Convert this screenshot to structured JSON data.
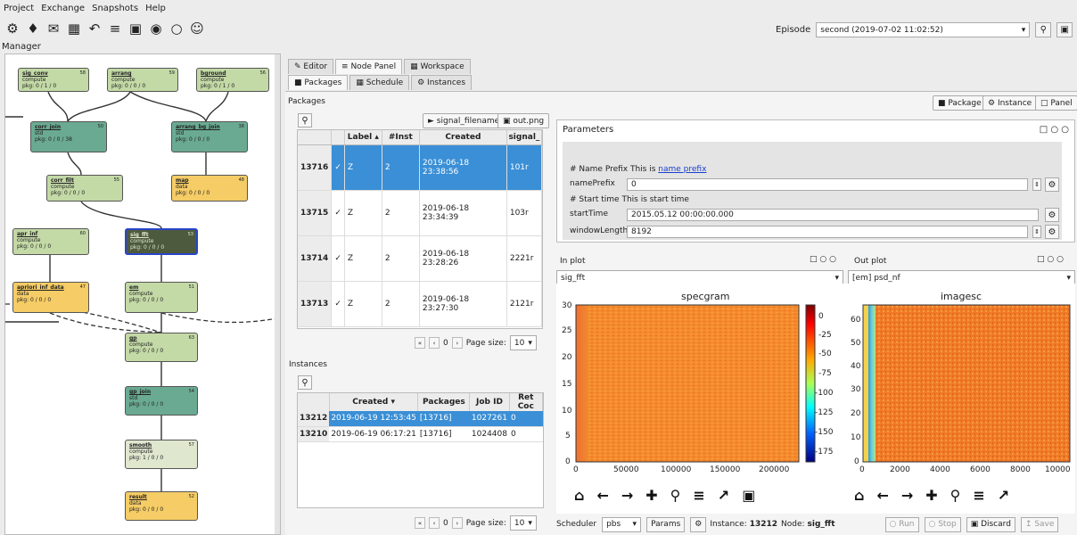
{
  "menu": [
    "Project",
    "Exchange",
    "Snapshots",
    "Help"
  ],
  "toolbar_icons": [
    "network-icon",
    "gem-icon",
    "chat-icon",
    "calendar-icon",
    "undo-icon",
    "sliders-icon",
    "camera-icon",
    "toggle-icon",
    "circle-icon",
    "smiley-icon"
  ],
  "manager_label": "Manager",
  "episode": {
    "label": "Episode",
    "value": "second (2019-07-02 11:02:52)"
  },
  "graph": {
    "nodes": [
      {
        "id": "sig_conv",
        "title": "sig_conv",
        "sub": "compute",
        "pkg": "pkg: 0 / 1 / 0",
        "num": "58",
        "cls": "g"
      },
      {
        "id": "arrang",
        "title": "arrang",
        "sub": "compute",
        "pkg": "pkg: 0 / 0 / 0",
        "num": "59",
        "cls": "g"
      },
      {
        "id": "bground",
        "title": "bground",
        "sub": "compute",
        "pkg": "pkg: 0 / 1 / 0",
        "num": "56",
        "cls": "g"
      },
      {
        "id": "corr_join",
        "title": "corr_join",
        "sub": "std",
        "pkg": "pkg: 0 / 0 / 38",
        "num": "50",
        "cls": "t"
      },
      {
        "id": "arrang_bg_join",
        "title": "arrang_bg_join",
        "sub": "std",
        "pkg": "pkg: 0 / 0 / 0",
        "num": "38",
        "cls": "t"
      },
      {
        "id": "corr_filt",
        "title": "corr_filt",
        "sub": "compute",
        "pkg": "pkg: 0 / 0 / 0",
        "num": "55",
        "cls": "g"
      },
      {
        "id": "map",
        "title": "map",
        "sub": "data",
        "pkg": "pkg: 0 / 0 / 0",
        "num": "48",
        "cls": "y"
      },
      {
        "id": "apr_inf",
        "title": "apr_inf",
        "sub": "compute",
        "pkg": "pkg: 0 / 0 / 0",
        "num": "60",
        "cls": "g"
      },
      {
        "id": "sig_fft",
        "title": "sig_fft",
        "sub": "compute",
        "pkg": "pkg: 0 / 0 / 0",
        "num": "53",
        "cls": "dk"
      },
      {
        "id": "apriori_inf_data",
        "title": "apriori_inf_data",
        "sub": "data",
        "pkg": "pkg: 0 / 0 / 0",
        "num": "47",
        "cls": "y"
      },
      {
        "id": "em",
        "title": "em",
        "sub": "compute",
        "pkg": "pkg: 0 / 0 / 0",
        "num": "51",
        "cls": "g"
      },
      {
        "id": "gp",
        "title": "gp",
        "sub": "compute",
        "pkg": "pkg: 0 / 0 / 0",
        "num": "63",
        "cls": "g"
      },
      {
        "id": "gp_join",
        "title": "gp_join",
        "sub": "std",
        "pkg": "pkg: 0 / 0 / 0",
        "num": "54",
        "cls": "t"
      },
      {
        "id": "smooth",
        "title": "smooth",
        "sub": "compute",
        "pkg": "pkg: 1 / 0 / 0",
        "num": "57",
        "cls": "p"
      },
      {
        "id": "result",
        "title": "result",
        "sub": "data",
        "pkg": "pkg: 0 / 0 / 0",
        "num": "52",
        "cls": "y"
      }
    ]
  },
  "tabs_main": [
    "Editor",
    "Node Panel",
    "Workspace"
  ],
  "tabs_sub": [
    "Packages",
    "Schedule",
    "Instances"
  ],
  "packages_label": "Packages",
  "instances_label": "Instances",
  "pkg_buttons": {
    "signal": "signal_filename",
    "out": "out.png"
  },
  "top_right_buttons": [
    "Package",
    "Instance",
    "Panel"
  ],
  "pkg_columns": [
    "",
    "Label",
    "#Inst",
    "Created",
    "signal_"
  ],
  "pkg_rows": [
    {
      "id": "13716",
      "label": "Z",
      "inst": "2",
      "created": "2019-06-18 23:38:56",
      "signal": "101r",
      "selected": true
    },
    {
      "id": "13715",
      "label": "Z",
      "inst": "2",
      "created": "2019-06-18 23:34:39",
      "signal": "103r",
      "selected": false
    },
    {
      "id": "13714",
      "label": "Z",
      "inst": "2",
      "created": "2019-06-18 23:28:26",
      "signal": "2221r",
      "selected": false
    },
    {
      "id": "13713",
      "label": "Z",
      "inst": "2",
      "created": "2019-06-18 23:27:30",
      "signal": "2121r",
      "selected": false
    }
  ],
  "pager": {
    "page": "0",
    "size_label": "Page size:",
    "size": "10"
  },
  "inst_columns": [
    "",
    "Created",
    "Packages",
    "Job ID",
    "Ret Coc"
  ],
  "inst_rows": [
    {
      "id": "13212",
      "created": "2019-06-19 12:53:45",
      "packages": "[13716]",
      "job": "1027261",
      "ret": "0",
      "selected": true
    },
    {
      "id": "13210",
      "created": "2019-06-19 06:17:21",
      "packages": "[13716]",
      "job": "1024408",
      "ret": "0",
      "selected": false
    }
  ],
  "params": {
    "title": "Parameters",
    "name_comment": "# Name Prefix This is",
    "name_link": "name prefix",
    "name_label": "namePrefix",
    "name_value": "0",
    "start_comment": "# Start time This is start time",
    "start_label": "startTime",
    "start_value": "2015.05.12 00:00:00.000",
    "window_label": "windowLength",
    "window_value": "8192"
  },
  "in_plot": {
    "label": "In plot",
    "select": "sig_fft"
  },
  "out_plot": {
    "label": "Out plot",
    "select": "[em] psd_nf"
  },
  "specgram": {
    "title": "specgram",
    "y_ticks": [
      "30",
      "25",
      "20",
      "15",
      "10",
      "5",
      "0"
    ],
    "x_ticks": [
      "0",
      "50000",
      "100000",
      "150000",
      "200000"
    ],
    "cbar_ticks": [
      "0",
      "-25",
      "-50",
      "-75",
      "-100",
      "-125",
      "-150",
      "-175"
    ]
  },
  "imagesc": {
    "title": "imagesc",
    "y_ticks": [
      "60",
      "50",
      "40",
      "30",
      "20",
      "10",
      "0"
    ],
    "x_ticks": [
      "0",
      "2000",
      "4000",
      "6000",
      "8000",
      "10000"
    ]
  },
  "status": {
    "scheduler_label": "Scheduler",
    "scheduler_value": "pbs",
    "params_btn": "Params",
    "instance_label": "Instance:",
    "instance_value": "13212",
    "node_label": "Node:",
    "node_value": "sig_fft",
    "run": "Run",
    "stop": "Stop",
    "discard": "Discard",
    "save": "Save"
  }
}
